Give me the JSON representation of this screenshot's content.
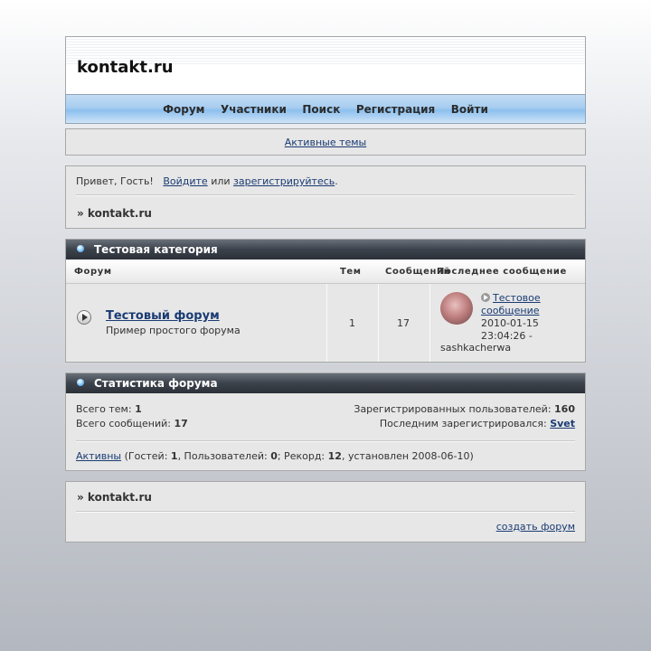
{
  "site": {
    "title": "kontakt.ru"
  },
  "nav": [
    "Форум",
    "Участники",
    "Поиск",
    "Регистрация",
    "Войти"
  ],
  "active_topics": "Активные темы",
  "welcome": {
    "greeting": "Привет, Гость!",
    "login": "Войдите",
    "or": "или",
    "register": "зарегистрируйтесь",
    "dot": ".",
    "breadcrumb": "» kontakt.ru"
  },
  "category": {
    "title": "Тестовая категория",
    "headers": {
      "forum": "Форум",
      "topics": "Тем",
      "posts": "Сообщений",
      "last": "Последнее сообщение"
    },
    "forum": {
      "name": "Тестовый форум",
      "description": "Пример простого форума",
      "topics": "1",
      "posts": "17",
      "last_post_title_1": "Тестовое",
      "last_post_title_2": "сообщение",
      "last_post_date": "2010-01-15",
      "last_post_time": "23:04:26 -",
      "last_post_author": "sashkacherwa"
    }
  },
  "stats": {
    "title": "Статистика форума",
    "topics_label": "Всего тем:",
    "topics_value": "1",
    "posts_label": "Всего сообщений:",
    "posts_value": "17",
    "users_label": "Зарегистрированных пользователей:",
    "users_value": "160",
    "last_reg_label": "Последним зарегистрировался:",
    "last_reg_value": "Svet",
    "active_link": "Активны",
    "guests_label": "(Гостей:",
    "guests_value": "1",
    "users_on_label": ", Пользователей:",
    "users_on_value": "0",
    "record_label": "; Рекорд:",
    "record_value": "12",
    "record_tail": ", установлен 2008-06-10)"
  },
  "footer": {
    "breadcrumb": "» kontakt.ru",
    "create_forum": "создать форум"
  },
  "colors": {
    "link": "#1a3b73",
    "nav_gradient": "#a7cdf0",
    "category_bar": "#3c424b"
  }
}
